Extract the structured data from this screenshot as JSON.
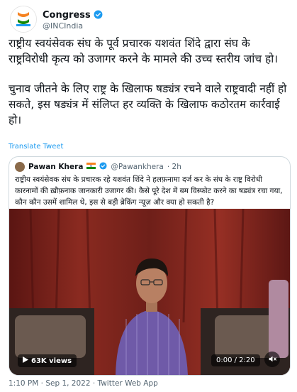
{
  "tweet": {
    "author_name": "Congress",
    "author_handle": "@INCIndia",
    "paragraph_1": "राष्ट्रीय स्वयंसेवक संघ के पूर्व प्रचारक यशवंत शिंदे द्वारा संघ के राष्ट्रविरोधी कृत्य को उजागर करने के मामले की उच्च स्तरीय जांच हो।",
    "paragraph_2": "चुनाव जीतने के लिए राष्ट्र के खिलाफ षड्यंत्र रचने वाले राष्ट्रवादी नहीं हो सकते, इस षड्यंत्र में संलिप्त हर व्यक्ति के खिलाफ कठोरतम कार्रवाई हो।",
    "translate_label": "Translate Tweet",
    "timestamp": "1:10 PM · Sep 1, 2022 · Twitter Web App"
  },
  "quoted": {
    "author_name": "Pawan Khera",
    "author_handle": "@Pawankhera",
    "age": "· 2h",
    "text": "राष्ट्रीय स्वयंसेवक संघ के प्रचारक रहे यशवंत शिंदे ने हलफ़नामा दर्ज कर के संघ के राष्ट्र विरोधी कारनामों की ख़ौफ़नाक जानकारी उजागर की। कैसे पूरे देश में बम विस्फोट करने का षड्यंत्र रचा गया, कौन कौन उसमें शामिल थे, इस से बड़ी ब्रेकिंग न्यूज़ और क्या हो सकती है?",
    "video": {
      "views": "63K views",
      "timecode": "0:00 / 2:20"
    }
  },
  "colors": {
    "verified": "#1d9bf0",
    "link": "#1d9bf0",
    "muted_text": "#536471"
  },
  "icons": [
    "verified-badge-icon",
    "india-flag-icon",
    "play-icon",
    "speaker-muted-icon"
  ]
}
